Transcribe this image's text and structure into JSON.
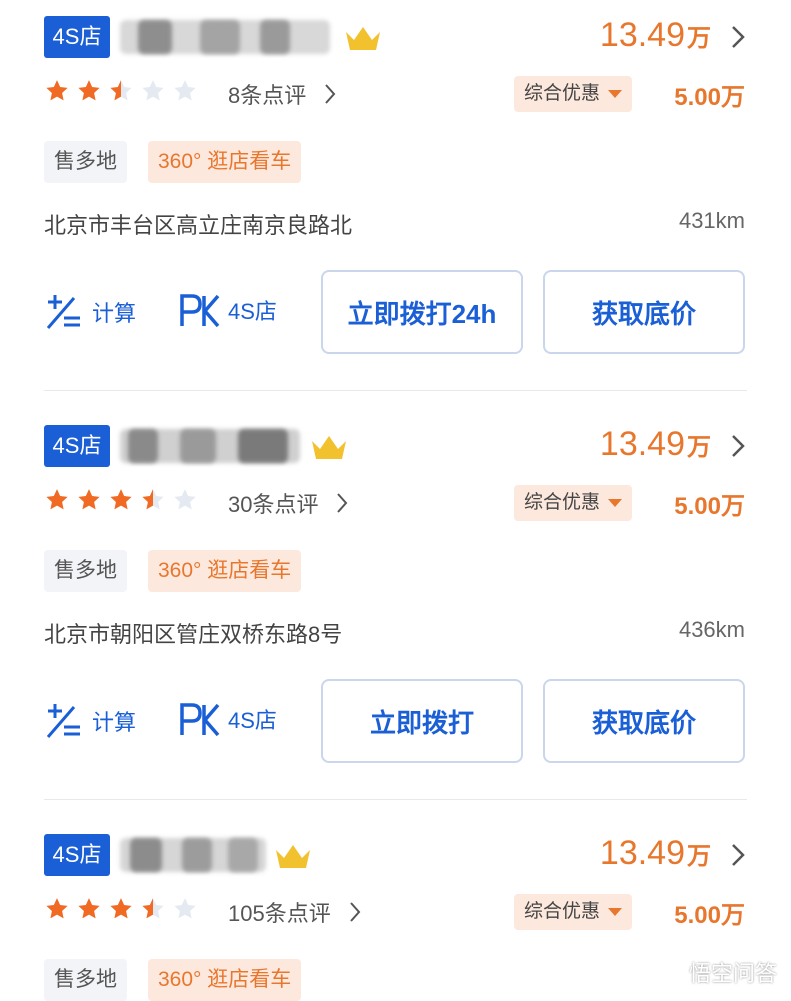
{
  "listings": [
    {
      "badge": "4S店",
      "price_num": "13.49",
      "price_unit": "万",
      "rating": 2.5,
      "review": "8条点评",
      "discount_label": "综合优惠",
      "discount_amount": "5.00万",
      "tags": [
        "售多地",
        "360° 逛店看车"
      ],
      "address": "北京市丰台区高立庄南京良路北",
      "distance": "431km",
      "calc_label": "计算",
      "pk_label": "4S店",
      "call_button": "立即拨打24h",
      "quote_button": "获取底价"
    },
    {
      "badge": "4S店",
      "price_num": "13.49",
      "price_unit": "万",
      "rating": 3.5,
      "review": "30条点评",
      "discount_label": "综合优惠",
      "discount_amount": "5.00万",
      "tags": [
        "售多地",
        "360° 逛店看车"
      ],
      "address": "北京市朝阳区管庄双桥东路8号",
      "distance": "436km",
      "calc_label": "计算",
      "pk_label": "4S店",
      "call_button": "立即拨打",
      "quote_button": "获取底价"
    },
    {
      "badge": "4S店",
      "price_num": "13.49",
      "price_unit": "万",
      "rating": 3.5,
      "review": "105条点评",
      "discount_label": "综合优惠",
      "discount_amount": "5.00万",
      "tags": [
        "售多地",
        "360° 逛店看车"
      ]
    }
  ],
  "colors": {
    "accent": "#e8772e",
    "brand": "#1a5fd6",
    "star_on": "#f06a24",
    "star_off": "#e4e9f2"
  },
  "icons": {
    "crown": "crown-icon",
    "chevron": "chevron-right-icon",
    "star": "star-icon",
    "calc": "calculator-icon",
    "pk": "pk-icon"
  },
  "watermark": {
    "text": "悟空问答"
  }
}
